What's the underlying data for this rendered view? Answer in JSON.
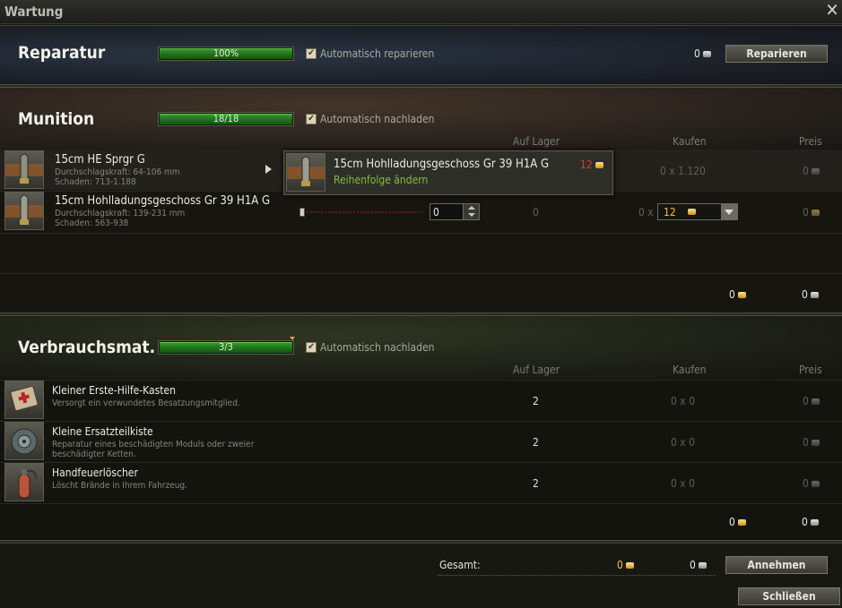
{
  "window": {
    "title": "Wartung"
  },
  "repair": {
    "title": "Reparatur",
    "progress_text": "100%",
    "progress": 1.0,
    "auto_label": "Automatisch reparieren",
    "cost": "0",
    "button": "Reparieren"
  },
  "ammo": {
    "title": "Munition",
    "progress_text": "18/18",
    "progress": 1.0,
    "auto_label": "Automatisch nachladen",
    "columns": {
      "stock": "Auf Lager",
      "buy": "Kaufen",
      "price": "Preis"
    },
    "rows": [
      {
        "name": "15cm HE Sprgr G",
        "line1": "Durchschlagskraft: 64-106 mm",
        "line2": "Schaden: 713-1.188",
        "stock": "",
        "buy": "0 x 1.120",
        "price": "0"
      },
      {
        "name": "15cm Hohlladungsgeschoss Gr 39 H1A G",
        "line1": "Durchschlagskraft: 139-231 mm",
        "line2": "Schaden: 563-938",
        "stock": "0",
        "spinner": "0",
        "buy_prefix": "0 x",
        "buy_select": "12",
        "price": "0"
      }
    ],
    "popup": {
      "name": "15cm Hohlladungsgeschoss Gr 39 H1A G",
      "price": "12",
      "action": "Reihenfolge ändern"
    },
    "total_gold": "0",
    "total_silver": "0"
  },
  "consumables": {
    "title": "Verbrauchsmat.",
    "progress_text": "3/3",
    "progress": 1.0,
    "auto_label": "Automatisch nachladen",
    "columns": {
      "stock": "Auf Lager",
      "buy": "Kaufen",
      "price": "Preis"
    },
    "rows": [
      {
        "name": "Kleiner Erste-Hilfe-Kasten",
        "desc": "Versorgt ein verwundetes Besatzungsmitglied.",
        "desc2": "",
        "stock": "2",
        "buy": "0 x 0",
        "price": "0"
      },
      {
        "name": "Kleine Ersatzteilkiste",
        "desc": "Reparatur eines beschädigten Moduls oder zweier",
        "desc2": "beschädigter Ketten.",
        "stock": "2",
        "buy": "0 x 0",
        "price": "0"
      },
      {
        "name": "Handfeuerlöscher",
        "desc": "Löscht Brände in Ihrem Fahrzeug.",
        "desc2": "",
        "stock": "2",
        "buy": "0 x 0",
        "price": "0"
      }
    ],
    "total_gold": "0",
    "total_silver": "0"
  },
  "footer": {
    "total_label": "Gesamt:",
    "total_gold": "0",
    "total_silver": "0",
    "accept": "Annehmen",
    "close": "Schließen"
  },
  "colors": {
    "progress_green": "#2c8a24",
    "gold": "#f2c23a",
    "popup_action": "#7fbf3a",
    "price_red": "#e03a2a"
  }
}
